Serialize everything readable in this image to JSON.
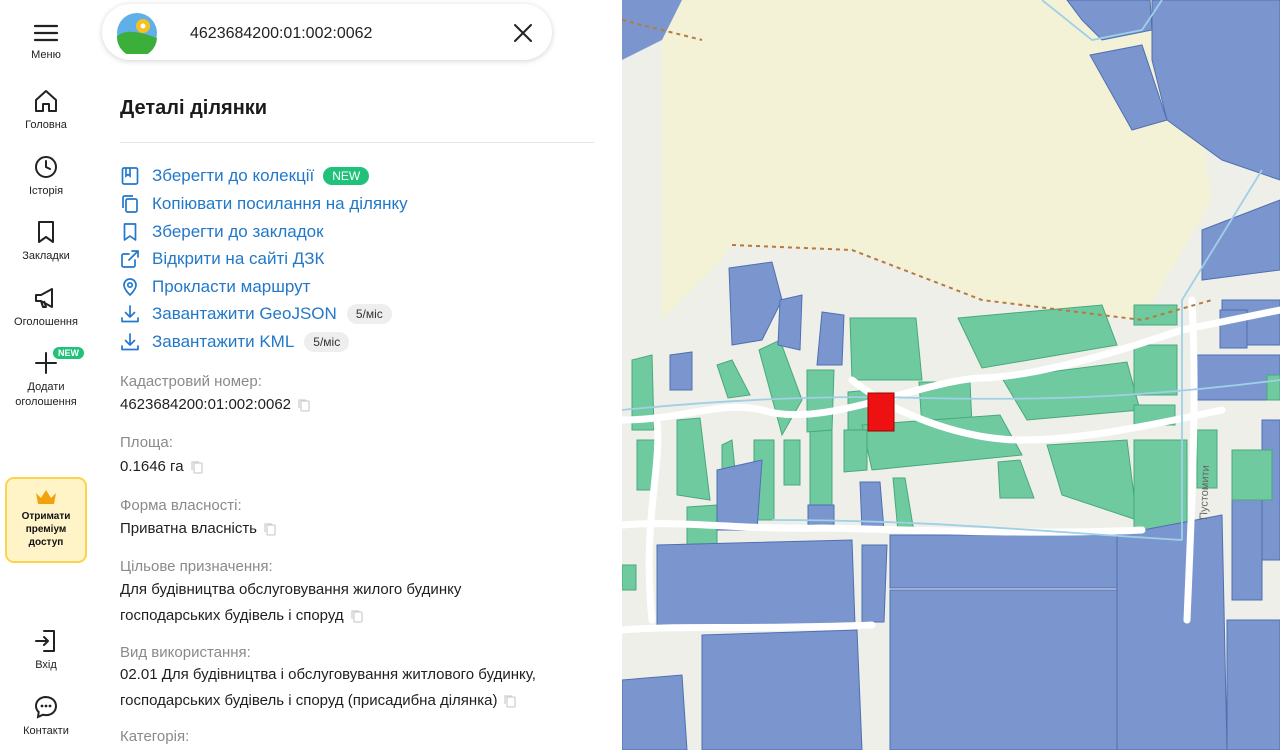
{
  "nav": {
    "menu": "Меню",
    "home": "Головна",
    "history": "Історія",
    "bookmarks": "Закладки",
    "ads": "Оголошення",
    "add_ad": "Додати оголошення",
    "add_ad_badge": "NEW",
    "premium": "Отримати преміум доступ",
    "login": "Вхід",
    "contacts": "Контакти"
  },
  "search": {
    "value": "4623684200:01:002:0062"
  },
  "panel": {
    "title": "Деталі ділянки",
    "actions": [
      {
        "label": "Зберегти до колекції",
        "badge": "NEW"
      },
      {
        "label": "Копіювати посилання на ділянку"
      },
      {
        "label": "Зберегти до закладок"
      },
      {
        "label": "Відкрити на сайті ДЗК"
      },
      {
        "label": "Прокласти маршрут"
      },
      {
        "label": "Завантажити GeoJSON",
        "limit": "5/міс"
      },
      {
        "label": "Завантажити KML",
        "limit": "5/міс"
      }
    ],
    "fields": {
      "cadastral_label": "Кадастровий номер:",
      "cadastral_value": "4623684200:01:002:0062",
      "area_label": "Площа:",
      "area_value": "0.1646 га",
      "ownership_label": "Форма власності:",
      "ownership_value": "Приватна власність",
      "purpose_label": "Цільове призначення:",
      "purpose_line1": "Для будівництва обслуговування жилого будинку",
      "purpose_line2": "господарських будівель і споруд",
      "usage_label": "Вид використання:",
      "usage_line1": "02.01 Для будівництва і обслуговування житлового будинку,",
      "usage_line2": "господарських будівель і споруд (присадибна ділянка)",
      "category_label": "Категорія:"
    }
  },
  "map": {
    "street_label": "Пустомити",
    "colors": {
      "residential": "#6fcaa0",
      "agricultural": "#6f8fca",
      "selected": "#ee1111",
      "field": "#f3f1d6",
      "road": "#ffffff"
    }
  }
}
